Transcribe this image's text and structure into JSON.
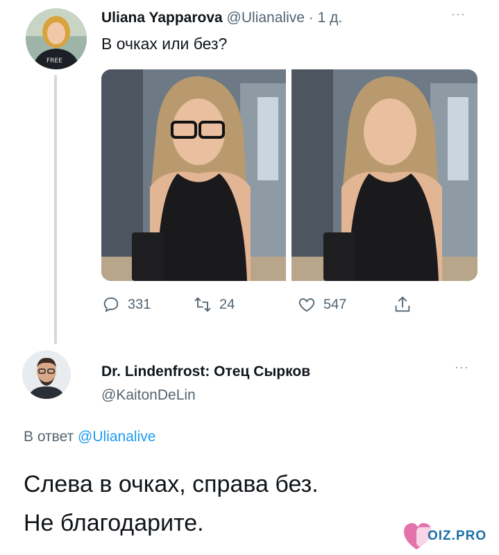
{
  "tweet1": {
    "author_name": "Uliana Yapparova",
    "author_handle": "@Ulianalive",
    "time_sep": " · ",
    "time": "1 д.",
    "text": "В очках или без?",
    "avatar_icon": "avatar-photo",
    "images": [
      {
        "icon": "photo-woman-with-glasses"
      },
      {
        "icon": "photo-woman-without-glasses"
      }
    ],
    "actions": {
      "reply_count": "331",
      "retweet_count": "24",
      "like_count": "547"
    },
    "more_label": "···"
  },
  "tweet2": {
    "author_name": "Dr. Lindenfrost: Отец Сырков",
    "author_handle": "@KaitonDeLin",
    "reply_prefix": "В ответ ",
    "reply_handle": "@Ulianalive",
    "text_line1": "Слева в очках, справа без.",
    "text_line2": "Не благодарите.",
    "more_label": "···"
  },
  "watermark": {
    "text": "OIZ.PRO"
  },
  "colors": {
    "text_primary": "#0f1419",
    "text_secondary": "#536471",
    "link": "#1d9bf0",
    "thread_line": "#cfd9de"
  }
}
